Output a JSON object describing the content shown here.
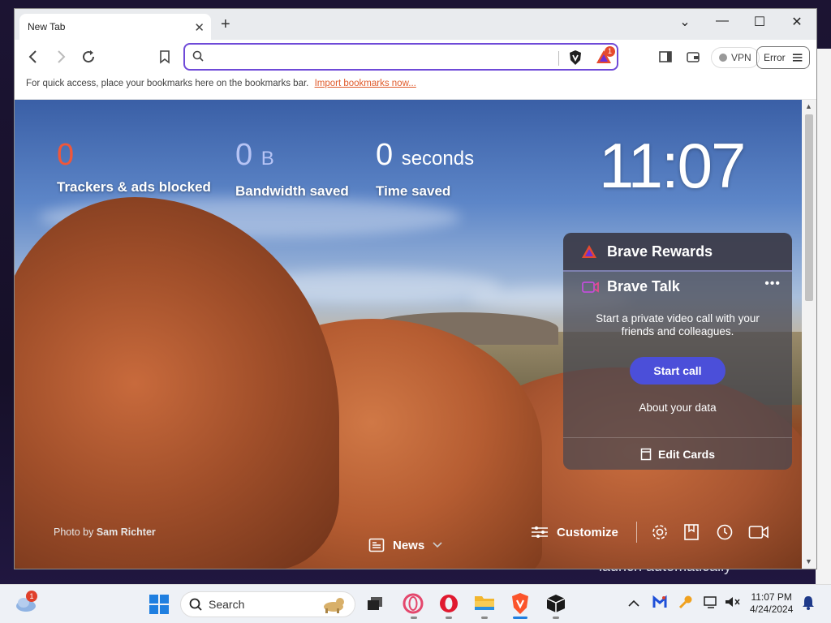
{
  "browser": {
    "tab_title": "New Tab",
    "url_placeholder": "",
    "rewards_badge": "1",
    "vpn_label": "VPN",
    "error_label": "Error"
  },
  "bookmarks_bar": {
    "hint": "For quick access, place your bookmarks here on the bookmarks bar.",
    "import_link": "Import bookmarks now..."
  },
  "stats": [
    {
      "value": "0",
      "unit": "",
      "label": "Trackers & ads blocked",
      "color": "#f0573a"
    },
    {
      "value": "0",
      "unit": "B",
      "label": "Bandwidth saved",
      "color": "#b7c4f5"
    },
    {
      "value": "0",
      "unit": "seconds",
      "label": "Time saved",
      "color": "#ffffff"
    }
  ],
  "clock": "11:07",
  "cards": {
    "rewards_title": "Brave Rewards",
    "talk_title": "Brave Talk",
    "talk_description": "Start a private video call with your friends and colleagues.",
    "start_call": "Start call",
    "about_data": "About your data",
    "edit_cards": "Edit Cards"
  },
  "photo_credit": {
    "prefix": "Photo by",
    "author": "Sam Richter"
  },
  "news_label": "News",
  "customize_label": "Customize",
  "desktop_text": "launch automatically",
  "taskbar": {
    "search_label": "Search",
    "weather_badge": "1",
    "time": "11:07 PM",
    "date": "4/24/2024"
  },
  "colors": {
    "accent": "#6f4ad8",
    "start_call_bg": "#4b4fd9",
    "import_link": "#e05a2a"
  }
}
